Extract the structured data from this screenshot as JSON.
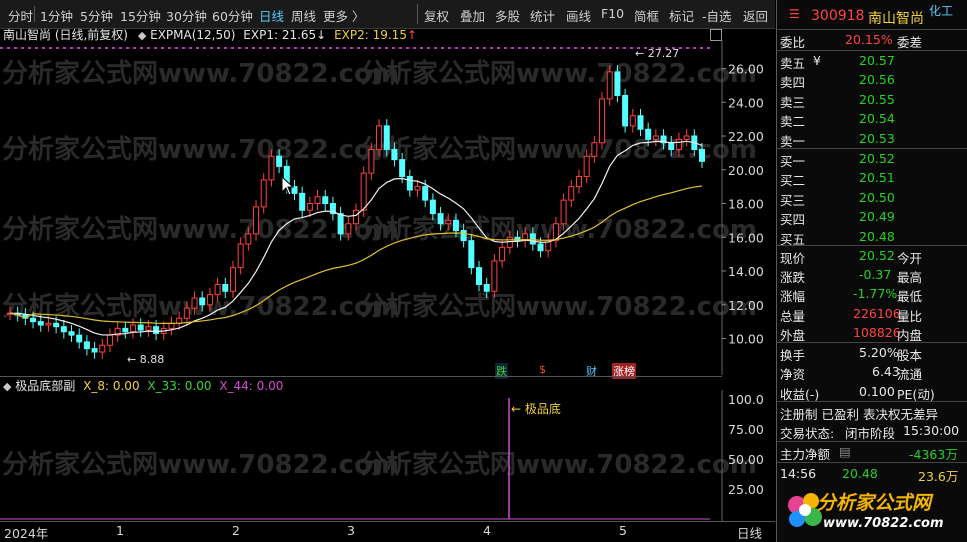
{
  "toolbar": {
    "periods": [
      "分时",
      "1分钟",
      "5分钟",
      "15分钟",
      "30分钟",
      "60分钟",
      "日线",
      "周线",
      "更多 〉"
    ],
    "active_period": "日线",
    "tools": [
      "复权",
      "叠加",
      "多股",
      "统计",
      "画线",
      "F10",
      "简框",
      "标记",
      "-自选",
      "返回"
    ]
  },
  "main_chart": {
    "title": "南山智尚 (日线,前复权)",
    "indicator": "EXPMA(12,50)",
    "exp1_label": "EXP1: 21.65",
    "exp1_arrow": "↓",
    "exp2_label": "EXP2: 19.15",
    "exp2_arrow": "↑",
    "high_label": "27.27",
    "low_label": "8.88",
    "y_ticks": [
      "26.00",
      "24.00",
      "22.00",
      "20.00",
      "18.00",
      "16.00",
      "14.00",
      "12.00",
      "10.00"
    ],
    "events": [
      "跌",
      "$",
      "财",
      "涨榜"
    ]
  },
  "sub_chart": {
    "title": "极品底部副",
    "x8": "X_8: 0.00",
    "x33": "X_33: 0.00",
    "x44": "X_44: 0.00",
    "signal_label": "极品底",
    "y_ticks": [
      "100.0",
      "75.00",
      "50.00",
      "25.00"
    ]
  },
  "x_axis": {
    "labels": [
      "2024年",
      "1",
      "2",
      "3",
      "4",
      "5"
    ],
    "right": "日线"
  },
  "watermark": "分析家公式网www.70822.com",
  "quote": {
    "code": "300918",
    "name": "南山智尚",
    "tag": "化工",
    "weibi_label": "委比",
    "weibi": "20.15%",
    "weicha_label": "委差",
    "asks": [
      {
        "label": "卖五",
        "price": "20.57"
      },
      {
        "label": "卖四",
        "price": "20.56"
      },
      {
        "label": "卖三",
        "price": "20.55"
      },
      {
        "label": "卖二",
        "price": "20.54"
      },
      {
        "label": "卖一",
        "price": "20.53"
      }
    ],
    "bids": [
      {
        "label": "买一",
        "price": "20.52"
      },
      {
        "label": "买二",
        "price": "20.51"
      },
      {
        "label": "买三",
        "price": "20.50"
      },
      {
        "label": "买四",
        "price": "20.49"
      },
      {
        "label": "买五",
        "price": "20.48"
      }
    ],
    "yen_mark": "¥",
    "stats": [
      {
        "l": "现价",
        "v": "20.52",
        "r": "今开",
        "c": "green"
      },
      {
        "l": "涨跌",
        "v": "-0.37",
        "r": "最高",
        "c": "green"
      },
      {
        "l": "涨幅",
        "v": "-1.77%",
        "r": "最低",
        "c": "green"
      },
      {
        "l": "总量",
        "v": "226106",
        "r": "量比",
        "c": "red"
      },
      {
        "l": "外盘",
        "v": "108826",
        "r": "内盘",
        "c": "red"
      }
    ],
    "stats2": [
      {
        "l": "换手",
        "v": "5.20%",
        "r": "股本"
      },
      {
        "l": "净资",
        "v": "6.43",
        "r": "流通"
      },
      {
        "l": "收益(-)",
        "v": "0.100",
        "r": "PE(动)"
      }
    ],
    "tags_line": "注册制 已盈利 表决权无差异",
    "status_label": "交易状态:",
    "status": "闭市阶段",
    "status_time": "15:30:00",
    "net_label": "主力净额",
    "net_value": "-4363万",
    "tick_time": "14:56",
    "tick_price": "20.48",
    "tick_vol": "23.6万"
  },
  "logo": {
    "text": "分析家公式网",
    "url": "www.70822.com"
  }
}
